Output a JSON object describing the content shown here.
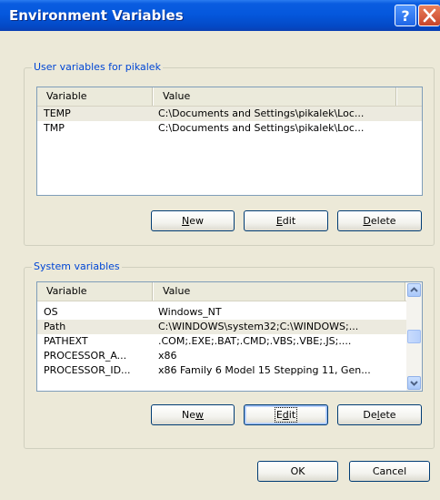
{
  "window": {
    "title": "Environment Variables",
    "help_icon": "question-mark-icon",
    "close_icon": "close-x-icon"
  },
  "user_vars": {
    "group_label": "User variables for pikalek",
    "columns": [
      "Variable",
      "Value"
    ],
    "rows": [
      {
        "variable": "TEMP",
        "value": "C:\\Documents and Settings\\pikalek\\Loc...",
        "selected": true
      },
      {
        "variable": "TMP",
        "value": "C:\\Documents and Settings\\pikalek\\Loc...",
        "selected": false
      }
    ],
    "buttons": {
      "new": "New",
      "edit": "Edit",
      "delete": "Delete"
    }
  },
  "system_vars": {
    "group_label": "System variables",
    "columns": [
      "Variable",
      "Value"
    ],
    "rows": [
      {
        "variable": "OS",
        "value": "Windows_NT",
        "selected": false
      },
      {
        "variable": "Path",
        "value": "C:\\WINDOWS\\system32;C:\\WINDOWS;...",
        "selected": true
      },
      {
        "variable": "PATHEXT",
        "value": ".COM;.EXE;.BAT;.CMD;.VBS;.VBE;.JS;....",
        "selected": false
      },
      {
        "variable": "PROCESSOR_A...",
        "value": "x86",
        "selected": false
      },
      {
        "variable": "PROCESSOR_ID...",
        "value": "x86 Family 6 Model 15 Stepping 11, Gen...",
        "selected": false
      }
    ],
    "buttons": {
      "new": "New",
      "edit": "Edit",
      "delete": "Delete"
    },
    "scroll_up_icon": "arrow-up-icon",
    "scroll_down_icon": "arrow-down-icon"
  },
  "footer": {
    "ok": "OK",
    "cancel": "Cancel"
  },
  "colors": {
    "title_bar": "#0558dd",
    "group_label": "#0046d5",
    "list_border": "#7f9db9",
    "dialog_face": "#ece9d8"
  }
}
